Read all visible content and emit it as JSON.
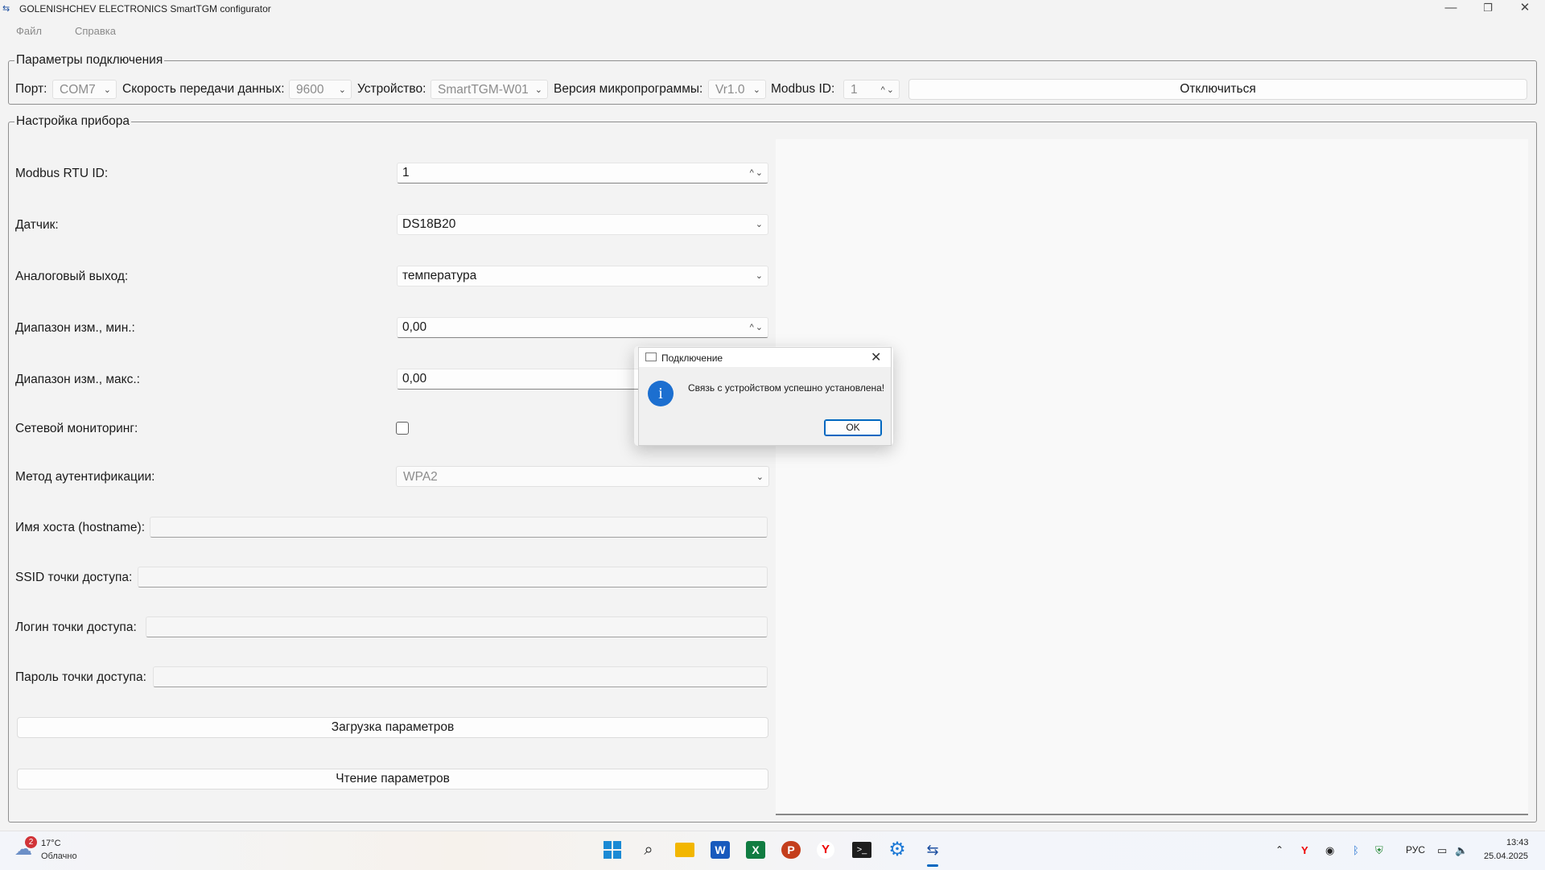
{
  "window": {
    "title": "GOLENISHCHEV ELECTRONICS SmartTGM configurator",
    "minimize": "—",
    "maximize": "❐",
    "close": "✕"
  },
  "menu": {
    "file": "Файл",
    "help": "Справка"
  },
  "connection": {
    "legend": "Параметры подключения",
    "port_label": "Порт:",
    "port_value": "COM7",
    "baud_label": "Скорость передачи данных:",
    "baud_value": "9600",
    "device_label": "Устройство:",
    "device_value": "SmartTGM-W01",
    "firmware_label": "Версия микропрограммы:",
    "firmware_value": "Vr1.0",
    "modbus_label": "Modbus ID:",
    "modbus_value": "1",
    "disconnect": "Отключиться"
  },
  "settings": {
    "legend": "Настройка прибора",
    "modbus_rtu_label": "Modbus RTU ID:",
    "modbus_rtu_value": "1",
    "sensor_label": "Датчик:",
    "sensor_value": "DS18B20",
    "analog_label": "Аналоговый выход:",
    "analog_value": "температура",
    "range_min_label": "Диапазон изм., мин.:",
    "range_min_value": "0,00",
    "range_max_label": "Диапазон изм., макс.:",
    "range_max_value": "0,00",
    "net_monitor_label": "Сетевой мониторинг:",
    "auth_label": "Метод аутентификации:",
    "auth_value": "WPA2",
    "hostname_label": "Имя хоста (hostname):",
    "ssid_label": "SSID точки доступа:",
    "login_label": "Логин точки доступа:",
    "password_label": "Пароль точки доступа:",
    "load_button": "Загрузка параметров",
    "read_button": "Чтение параметров"
  },
  "dialog": {
    "title": "Подключение",
    "message": "Связь с устройством успешно установлена!",
    "ok": "OK",
    "info_glyph": "i",
    "close": "✕"
  },
  "taskbar": {
    "weather_temp": "17°C",
    "weather_desc": "Облачно",
    "weather_badge": "2",
    "lang": "РУС",
    "time": "13:43",
    "date": "25.04.2025"
  },
  "colors": {
    "accent": "#0067c0",
    "info_icon": "#1c6fd0",
    "badge": "#d13438"
  }
}
